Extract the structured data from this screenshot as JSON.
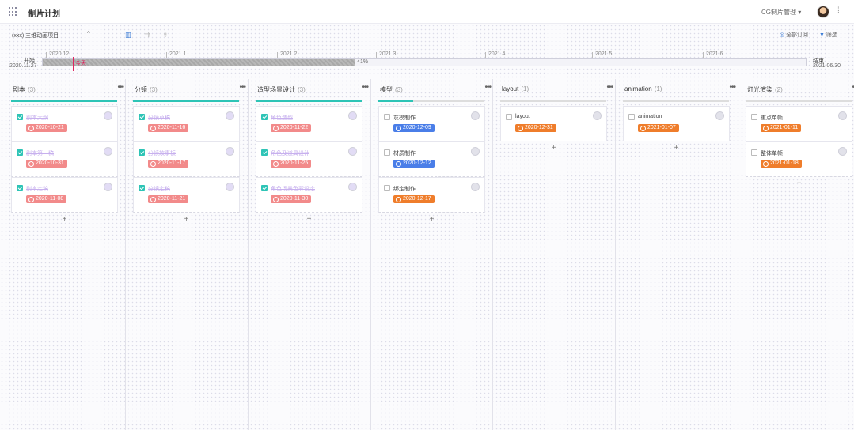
{
  "header": {
    "title": "制片计划",
    "user_select": "CG制片管理 ▾",
    "more": "⁞"
  },
  "subbar": {
    "project": "(xxx) 三维动画项目",
    "project_arrow": "^",
    "view_icons": [
      "▥",
      "⇉",
      "⇟"
    ],
    "subscribe": "全部订阅",
    "filter": "筛选"
  },
  "timeline": {
    "start_label": "开始",
    "start_date": "2020.11.27",
    "end_label": "结束",
    "end_date": "2021.06.30",
    "progress": 0.41,
    "progress_text": "41%",
    "today": "今天",
    "months": [
      "2020.12",
      "2021.1",
      "2021.2",
      "2021.3",
      "2021.4",
      "2021.5",
      "2021.6"
    ]
  },
  "columns": [
    {
      "title": "剧本",
      "count": "(3)",
      "bar": "done",
      "cards": [
        {
          "text": "剧本大纲",
          "due": "2020-10-21",
          "color": "red",
          "done": true
        },
        {
          "text": "剧本第一稿",
          "due": "2020-10-31",
          "color": "red",
          "done": true
        },
        {
          "text": "剧本定稿",
          "due": "2020-11-08",
          "color": "red",
          "done": true
        }
      ]
    },
    {
      "title": "分镜",
      "count": "(3)",
      "bar": "done",
      "cards": [
        {
          "text": "分镜草稿",
          "due": "2020-11-16",
          "color": "red",
          "done": true
        },
        {
          "text": "分镜故事板",
          "due": "2020-11-17",
          "color": "red",
          "done": true
        },
        {
          "text": "分镜定稿",
          "due": "2020-11-21",
          "color": "red",
          "done": true
        }
      ]
    },
    {
      "title": "造型场景设计",
      "count": "(3)",
      "bar": "done",
      "cards": [
        {
          "text": "角色造型",
          "due": "2020-11-22",
          "color": "red",
          "done": true
        },
        {
          "text": "角色及道具设计",
          "due": "2020-11-25",
          "color": "red",
          "done": true
        },
        {
          "text": "角色场景色彩设定",
          "due": "2020-11-30",
          "color": "red",
          "done": true
        }
      ]
    },
    {
      "title": "模型",
      "count": "(3)",
      "bar": "partial",
      "cards": [
        {
          "text": "灰模制作",
          "due": "2020-12-09",
          "color": "blue",
          "done": false
        },
        {
          "text": "材质制作",
          "due": "2020-12-12",
          "color": "blue",
          "done": false
        },
        {
          "text": "绑定制作",
          "due": "2020-12-17",
          "color": "orange",
          "done": false
        }
      ]
    },
    {
      "title": "layout",
      "count": "(1)",
      "bar": "none",
      "cards": [
        {
          "text": "layout",
          "due": "2020-12-31",
          "color": "orange",
          "done": false
        }
      ]
    },
    {
      "title": "animation",
      "count": "(1)",
      "bar": "none",
      "cards": [
        {
          "text": "animation",
          "due": "2021-01-07",
          "color": "orange",
          "done": false
        }
      ]
    },
    {
      "title": "灯光渲染",
      "count": "(2)",
      "bar": "none",
      "cards": [
        {
          "text": "重点单帧",
          "due": "2021-01-11",
          "color": "orange",
          "done": false
        },
        {
          "text": "整体单帧",
          "due": "2021-01-18",
          "color": "orange",
          "done": false
        }
      ]
    }
  ],
  "add_label": "+",
  "more_label": "•••"
}
